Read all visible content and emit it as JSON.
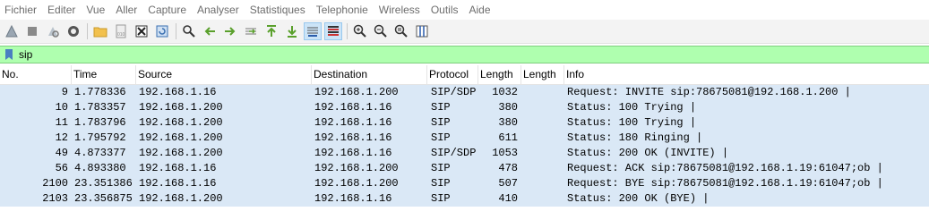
{
  "menu": [
    {
      "label": "Fichier"
    },
    {
      "label": "Editer"
    },
    {
      "label": "Vue"
    },
    {
      "label": "Aller"
    },
    {
      "label": "Capture"
    },
    {
      "label": "Analyser"
    },
    {
      "label": "Statistiques"
    },
    {
      "label": "Telephonie"
    },
    {
      "label": "Wireless"
    },
    {
      "label": "Outils"
    },
    {
      "label": "Aide"
    }
  ],
  "filter": {
    "value": "sip"
  },
  "columns": [
    "No.",
    "Time",
    "Source",
    "Destination",
    "Protocol",
    "Length",
    "Length",
    "Info"
  ],
  "packets": [
    {
      "no": "9",
      "time": "1.778336",
      "source": "192.168.1.16",
      "destination": "192.168.1.200",
      "protocol": "SIP/SDP",
      "length": "1032",
      "length2": "",
      "info": "Request: INVITE sip:78675081@192.168.1.200 |"
    },
    {
      "no": "10",
      "time": "1.783357",
      "source": "192.168.1.200",
      "destination": "192.168.1.16",
      "protocol": "SIP",
      "length": "380",
      "length2": "",
      "info": "Status: 100 Trying |"
    },
    {
      "no": "11",
      "time": "1.783796",
      "source": "192.168.1.200",
      "destination": "192.168.1.16",
      "protocol": "SIP",
      "length": "380",
      "length2": "",
      "info": "Status: 100 Trying |"
    },
    {
      "no": "12",
      "time": "1.795792",
      "source": "192.168.1.200",
      "destination": "192.168.1.16",
      "protocol": "SIP",
      "length": "611",
      "length2": "",
      "info": "Status: 180 Ringing |"
    },
    {
      "no": "49",
      "time": "4.873377",
      "source": "192.168.1.200",
      "destination": "192.168.1.16",
      "protocol": "SIP/SDP",
      "length": "1053",
      "length2": "",
      "info": "Status: 200 OK (INVITE) |"
    },
    {
      "no": "56",
      "time": "4.893380",
      "source": "192.168.1.16",
      "destination": "192.168.1.200",
      "protocol": "SIP",
      "length": "478",
      "length2": "",
      "info": "Request: ACK sip:78675081@192.168.1.19:61047;ob |"
    },
    {
      "no": "2100",
      "time": "23.351386",
      "source": "192.168.1.16",
      "destination": "192.168.1.200",
      "protocol": "SIP",
      "length": "507",
      "length2": "",
      "info": "Request: BYE sip:78675081@192.168.1.19:61047;ob |"
    },
    {
      "no": "2103",
      "time": "23.356875",
      "source": "192.168.1.200",
      "destination": "192.168.1.16",
      "protocol": "SIP",
      "length": "410",
      "length2": "",
      "info": "Status: 200 OK (BYE) |"
    }
  ],
  "colors": {
    "row_bg": "#dae8f6",
    "filter_bg": "#afffaf"
  }
}
